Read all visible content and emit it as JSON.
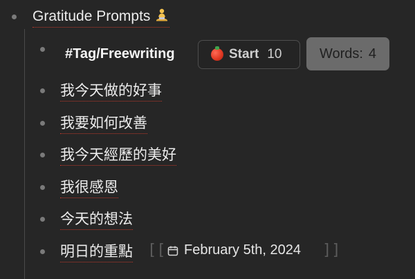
{
  "title": {
    "text": "Gratitude Prompts",
    "emoji_icon": "meditation-emoji-icon"
  },
  "tag": {
    "label": "#Tag/Freewriting"
  },
  "pomodoro": {
    "label": "Start",
    "count": "10",
    "icon": "tomato-icon"
  },
  "word_count": {
    "label": "Words:",
    "value": "4"
  },
  "items": [
    {
      "text": "我今天做的好事"
    },
    {
      "text": "我要如何改善"
    },
    {
      "text": "我今天經歷的美好"
    },
    {
      "text": "我很感恩"
    },
    {
      "text": "今天的想法"
    },
    {
      "text": "明日的重點"
    }
  ],
  "date_ref": {
    "open_bracket": "[[",
    "close_bracket": "]]",
    "date": "February 5th, 2024",
    "icon": "calendar-icon"
  },
  "colors": {
    "background": "#262626",
    "bullet": "#7a7a7a",
    "underline": "#c0392b",
    "words_button": "#6b6b6b"
  }
}
